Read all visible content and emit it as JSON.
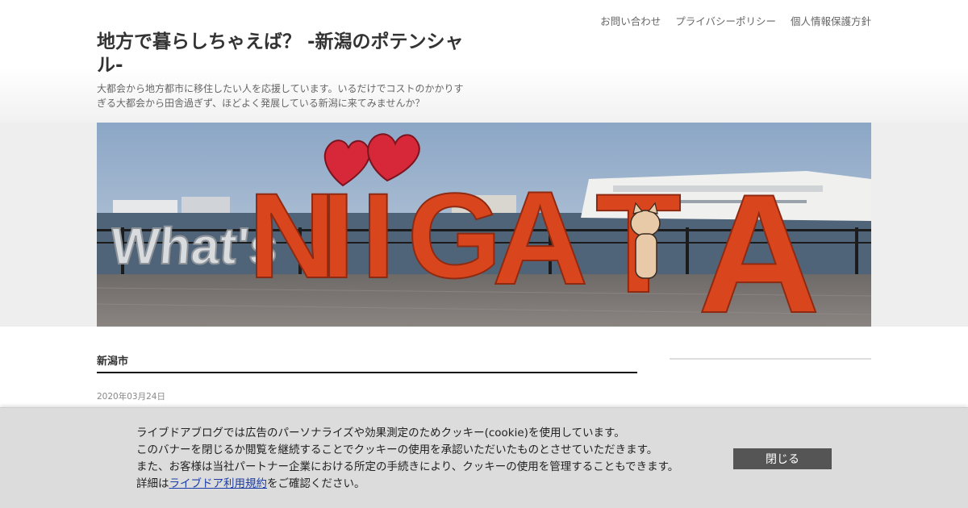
{
  "nav": {
    "links": [
      "お問い合わせ",
      "プライバシーポリシー",
      "個人情報保護方針"
    ]
  },
  "site": {
    "title": "地方で暮らしちゃえば？ -新潟のポテンシャル-",
    "description": "大都会から地方都市に移住したい人を応援しています。いるだけでコストのかかりすぎる大都会から田舎過ぎず、ほどよく発展している新潟に来てみませんか？"
  },
  "hero": {
    "sign_small": "What's",
    "sign_letters": [
      "N",
      "I",
      "I",
      "G",
      "A",
      "T",
      "A"
    ]
  },
  "main": {
    "category_title": "新潟市",
    "post_date": "2020年03月24日"
  },
  "cookie": {
    "line1": "ライブドアブログでは広告のパーソナライズや効果測定のためクッキー(cookie)を使用しています。",
    "line2": "このバナーを閉じるか閲覧を継続することでクッキーの使用を承認いただいたものとさせていただきます。",
    "line3": "また、お客様は当社パートナー企業における所定の手続きにより、クッキーの使用を管理することもできます。",
    "line4_prefix": "詳細は",
    "line4_link": "ライブドア利用規約",
    "line4_suffix": "をご確認ください。",
    "close_label": "閉じる"
  },
  "colors": {
    "sign_orange": "#d9461e",
    "heart_red": "#d62838",
    "close_button_bg": "#555555",
    "banner_bg": "#dcdcdc"
  }
}
